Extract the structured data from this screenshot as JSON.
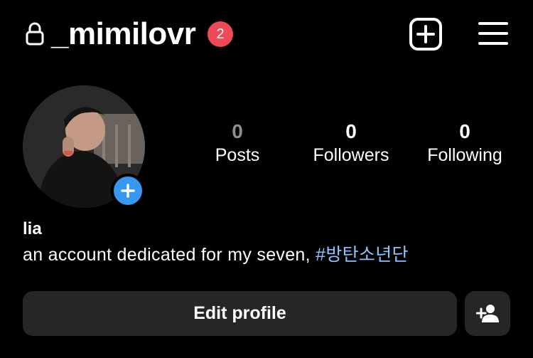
{
  "header": {
    "lock_icon": "lock-icon",
    "username": "_mimilovr",
    "notification_count": "2",
    "new_post_icon": "plus-square-icon",
    "menu_icon": "hamburger-menu-icon"
  },
  "stats": [
    {
      "value": "0",
      "label": "Posts"
    },
    {
      "value": "0",
      "label": "Followers"
    },
    {
      "value": "0",
      "label": "Following"
    }
  ],
  "profile": {
    "name": "lia",
    "bio_text": "an account dedicated for my seven, ",
    "bio_hashtag": "#방탄소년단"
  },
  "actions": {
    "edit_profile_label": "Edit profile",
    "suggest_icon": "add-person-icon"
  },
  "colors": {
    "background": "#000000",
    "badge": "#ed4956",
    "story_add": "#3897f0",
    "hashtag": "#8ec5ff",
    "button_bg": "#262626"
  }
}
